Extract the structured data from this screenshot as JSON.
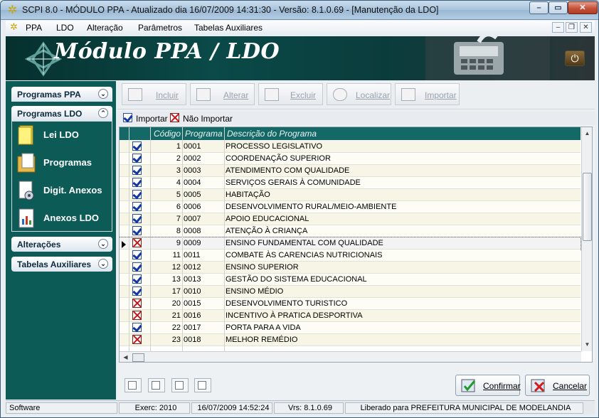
{
  "window": {
    "title": "SCPI 8.0 - MÓDULO PPA - Atualizado dia 16/07/2009 14:31:30 - Versão: 8.1.0.69 - [Manutenção da LDO]",
    "controls": {
      "minimize": "–",
      "maximize": "▭",
      "close": "✕"
    }
  },
  "menu": {
    "items": [
      "PPA",
      "LDO",
      "Alteração",
      "Parâmetros",
      "Tabelas Auxiliares"
    ],
    "mdi_controls": {
      "minimize": "–",
      "restore": "❐",
      "close": "✕"
    }
  },
  "banner": {
    "title": "Módulo PPA / LDO",
    "power": "⏻"
  },
  "sidebar": {
    "groups": {
      "ppa": "Programas PPA",
      "ldo": "Programas LDO",
      "alteracoes": "Alterações",
      "tabelas": "Tabelas Auxiliares"
    },
    "links": [
      "Lei LDO",
      "Programas",
      "Digit. Anexos",
      "Anexos LDO"
    ]
  },
  "toolbar": {
    "incluir": "Incluir",
    "alterar": "Alterar",
    "excluir": "Excluir",
    "localizar": "Localizar",
    "importar": "Importar"
  },
  "legend": {
    "importar": "Importar",
    "nao_importar": "Não Importar"
  },
  "grid": {
    "headers": {
      "codigo": "Código",
      "programa": "Programa",
      "descricao": "Descrição do Programa"
    },
    "rows": [
      {
        "checked": true,
        "codigo": "1",
        "programa": "0001",
        "descricao": "PROCESSO LEGISLATIVO"
      },
      {
        "checked": true,
        "codigo": "2",
        "programa": "0002",
        "descricao": "COORDENAÇÃO SUPERIOR"
      },
      {
        "checked": true,
        "codigo": "3",
        "programa": "0003",
        "descricao": "ATENDIMENTO COM QUALIDADE"
      },
      {
        "checked": true,
        "codigo": "4",
        "programa": "0004",
        "descricao": "SERVIÇOS GERAIS À COMUNIDADE"
      },
      {
        "checked": true,
        "codigo": "5",
        "programa": "0005",
        "descricao": "HABITAÇÃO"
      },
      {
        "checked": true,
        "codigo": "6",
        "programa": "0006",
        "descricao": "DESENVOLVIMENTO RURAL/MEIO-AMBIENTE"
      },
      {
        "checked": true,
        "codigo": "7",
        "programa": "0007",
        "descricao": "APOIO EDUCACIONAL"
      },
      {
        "checked": true,
        "codigo": "8",
        "programa": "0008",
        "descricao": "ATENÇÃO À CRIANÇA"
      },
      {
        "checked": false,
        "codigo": "9",
        "programa": "0009",
        "descricao": "ENSINO FUNDAMENTAL COM QUALIDADE",
        "selected": true
      },
      {
        "checked": true,
        "codigo": "11",
        "programa": "0011",
        "descricao": "COMBATE ÀS CARENCIAS  NUTRICIONAIS"
      },
      {
        "checked": true,
        "codigo": "12",
        "programa": "0012",
        "descricao": "ENSINO SUPERIOR"
      },
      {
        "checked": true,
        "codigo": "13",
        "programa": "0013",
        "descricao": "GESTÃO DO SISTEMA EDUCACIONAL"
      },
      {
        "checked": true,
        "codigo": "17",
        "programa": "0010",
        "descricao": "ENSINO MÉDIO"
      },
      {
        "checked": false,
        "codigo": "20",
        "programa": "0015",
        "descricao": "DESENVOLVIMENTO TURISTICO"
      },
      {
        "checked": false,
        "codigo": "21",
        "programa": "0016",
        "descricao": "INCENTIVO À PRATICA DESPORTIVA"
      },
      {
        "checked": true,
        "codigo": "22",
        "programa": "0017",
        "descricao": "PORTA PARA A VIDA"
      },
      {
        "checked": false,
        "codigo": "23",
        "programa": "0018",
        "descricao": "MELHOR REMÉDIO"
      }
    ]
  },
  "actions": {
    "confirmar": "Confirmar",
    "cancelar": "Cancelar"
  },
  "status": {
    "software": "Software",
    "exercicio": "Exerc: 2010",
    "datetime": "16/07/2009 14:52:24",
    "version": "Vrs: 8.1.0.69",
    "license": "Liberado para PREFEITURA MUNICIPAL DE MODELANDIA"
  }
}
